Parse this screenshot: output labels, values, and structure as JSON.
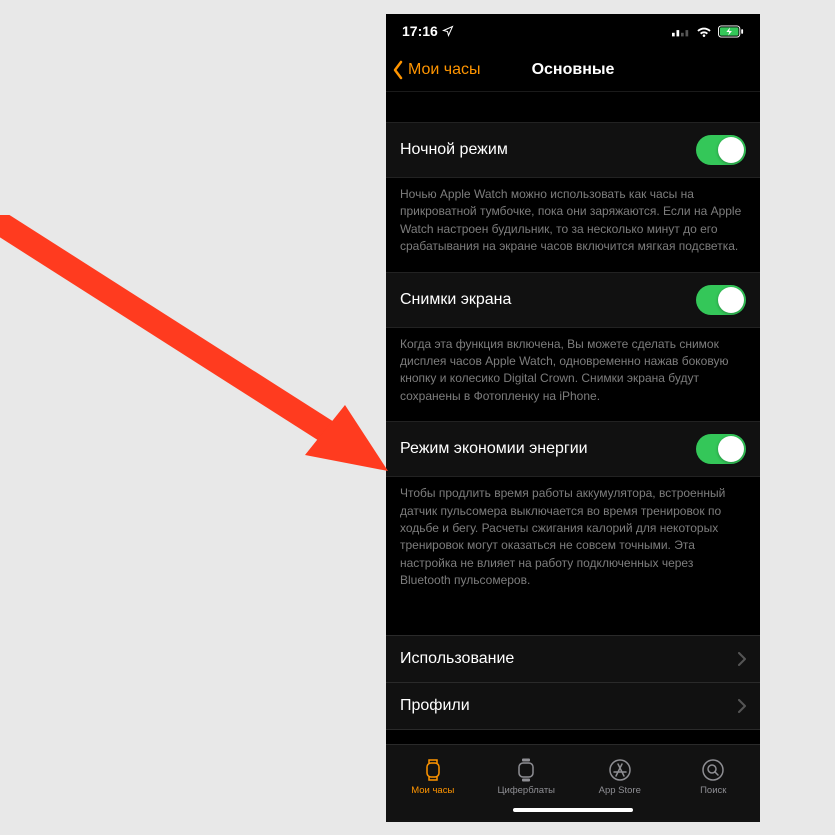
{
  "statusBar": {
    "time": "17:16"
  },
  "nav": {
    "back": "Мои часы",
    "title": "Основные"
  },
  "settings": {
    "nightMode": {
      "label": "Ночной режим",
      "desc": "Ночью Apple Watch можно использовать как часы на прикроватной тумбочке, пока они заряжаются. Если на Apple Watch настроен будильник, то за несколько минут до его срабатывания на экране часов включится мягкая подсветка."
    },
    "screenshots": {
      "label": "Снимки экрана",
      "desc": "Когда эта функция включена, Вы можете сделать снимок дисплея часов Apple Watch, одновременно нажав боковую кнопку и колесико Digital Crown. Снимки экрана будут сохранены в Фотопленку на iPhone."
    },
    "powerSave": {
      "label": "Режим экономии энергии",
      "desc": "Чтобы продлить время работы аккумулятора, встроенный датчик пульсомера выключается во время тренировок по ходьбе и бегу. Расчеты сжигания калорий для некоторых тренировок могут оказаться не совсем точными. Эта настройка не влияет на работу подключенных через Bluetooth пульсомеров."
    },
    "usage": {
      "label": "Использование"
    },
    "profiles": {
      "label": "Профили"
    }
  },
  "tabs": {
    "watch": "Мои часы",
    "faces": "Циферблаты",
    "appstore": "App Store",
    "search": "Поиск"
  }
}
